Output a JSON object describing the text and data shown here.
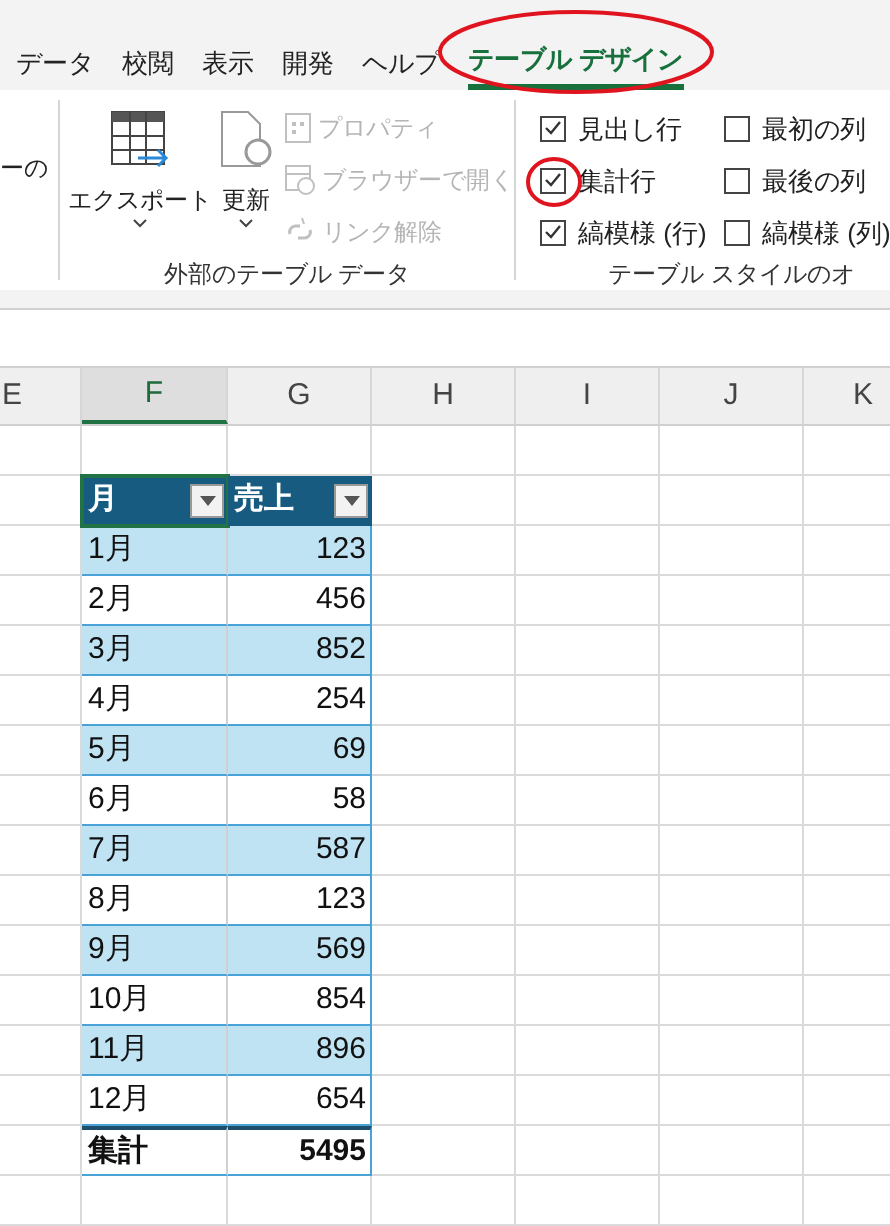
{
  "ribbon_tabs": [
    {
      "label": "データ",
      "selected": false
    },
    {
      "label": "校閲",
      "selected": false
    },
    {
      "label": "表示",
      "selected": false
    },
    {
      "label": "開発",
      "selected": false
    },
    {
      "label": "ヘルプ",
      "selected": false
    },
    {
      "label": "テーブル デザイン",
      "selected": true,
      "circled": true
    }
  ],
  "ribbon": {
    "left_fragment": "ーの",
    "external_group": {
      "label": "外部のテーブル データ",
      "export": {
        "label": "エクスポート"
      },
      "refresh": {
        "label": "更新"
      },
      "commands": [
        {
          "kind": "properties",
          "label": "プロパティ",
          "disabled": true
        },
        {
          "kind": "browser",
          "label": "ブラウザーで開く",
          "disabled": true
        },
        {
          "kind": "unlink",
          "label": "リンク解除",
          "disabled": true
        }
      ]
    },
    "style_options": {
      "label": "テーブル スタイルのオ",
      "options": [
        {
          "label": "見出し行",
          "checked": true,
          "circled": false
        },
        {
          "label": "最初の列",
          "checked": false,
          "circled": false
        },
        {
          "label": "集計行",
          "checked": true,
          "circled": true
        },
        {
          "label": "最後の列",
          "checked": false,
          "circled": false
        },
        {
          "label": "縞模様 (行)",
          "checked": true,
          "circled": false
        },
        {
          "label": "縞模様 (列)",
          "checked": false,
          "circled": false
        }
      ]
    }
  },
  "sheet": {
    "columns": [
      {
        "label": "E",
        "selected": false
      },
      {
        "label": "F",
        "selected": true
      },
      {
        "label": "G",
        "selected": false
      },
      {
        "label": "H",
        "selected": false
      },
      {
        "label": "I",
        "selected": false
      },
      {
        "label": "J",
        "selected": false
      },
      {
        "label": "K",
        "selected": false
      }
    ],
    "table": {
      "headers": [
        "月",
        "売上"
      ],
      "rows": [
        [
          "1月",
          "123"
        ],
        [
          "2月",
          "456"
        ],
        [
          "3月",
          "852"
        ],
        [
          "4月",
          "254"
        ],
        [
          "5月",
          "69"
        ],
        [
          "6月",
          "58"
        ],
        [
          "7月",
          "587"
        ],
        [
          "8月",
          "123"
        ],
        [
          "9月",
          "569"
        ],
        [
          "10月",
          "854"
        ],
        [
          "11月",
          "896"
        ],
        [
          "12月",
          "654"
        ]
      ],
      "total": [
        "集計",
        "5495"
      ]
    }
  }
}
